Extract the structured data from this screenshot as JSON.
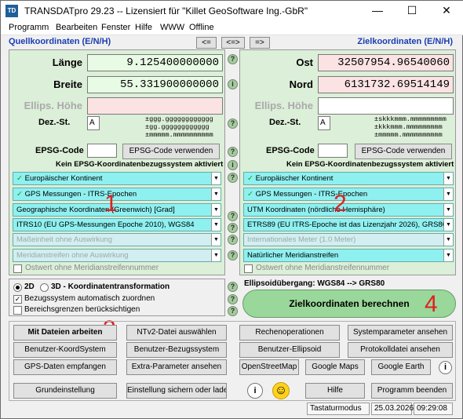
{
  "window": {
    "title": "TRANSDATpro 29.23 -- Lizensiert für \"Killet GeoSoftware Ing.-GbR\"",
    "icon": "TD",
    "controls": [
      "—",
      "☐",
      "✕"
    ]
  },
  "menu": [
    "Programm",
    "Bearbeiten",
    "Fenster",
    "Hilfe",
    "WWW",
    "Offline"
  ],
  "source": {
    "header": "Quellkoordinaten (E/N/H)",
    "label1": "Länge",
    "value1": "9.125400000000",
    "label2": "Breite",
    "value2": "55.331900000000",
    "label3": "Ellips. Höhe",
    "value3": "",
    "dez_label": "Dez.-St.",
    "dez_value": "A",
    "fmt": "±ggg.gggggggggggg\n±gg.gggggggggggg\n±mmmmm.mmmmmmmmmm",
    "epsg_label": "EPSG-Code",
    "epsg_value": "",
    "epsg_button": "EPSG-Code verwenden",
    "epsg_status": "Kein EPSG-Koordinatenbezugssystem aktiviert",
    "dropdowns": [
      "Europäischer Kontinent",
      "GPS Messungen - ITRS-Epochen",
      "Geographische Koordinaten (Greenwich) [Grad]",
      "ITRS10 (EU GPS-Messungen Epoche 2010), WGS84",
      "Maßeinheit ohne Auswirkung",
      "Meridianstreifen ohne Auswirkung"
    ],
    "ostwert": "Ostwert ohne Meridianstreifennummer"
  },
  "target": {
    "header": "Zielkoordinaten (E/N/H)",
    "label1": "Ost",
    "value1": "32507954.96540060",
    "label2": "Nord",
    "value2": "6131732.69514149",
    "label3": "Ellips. Höhe",
    "value3": "",
    "dez_label": "Dez.-St.",
    "dez_value": "A",
    "fmt": "±skkkmmm.mmmmmmmmm\n±kkkmmm.mmmmmmmmm\n±mmmmm.mmmmmmmmmm",
    "epsg_label": "EPSG-Code",
    "epsg_value": "",
    "epsg_button": "EPSG-Code verwenden",
    "epsg_status": "Kein EPSG-Koordinatenbezugssystem aktiviert",
    "dropdowns": [
      "Europäischer Kontinent",
      "GPS Messungen - ITRS-Epochen",
      "UTM Koordinaten (nördliche Hemisphäre)",
      "ETRS89 (EU ITRS-Epoche ist das Lizenzjahr 2026), GRS80",
      "Internationales Meter (1.0 Meter)",
      "Natürlicher Meridianstreifen"
    ],
    "ostwert": "Ostwert ohne Meridianstreifennummer"
  },
  "swap": {
    "left": "<=",
    "both": "<=>",
    "right": "=>"
  },
  "options": {
    "radio2d": "2D",
    "radio3d": "3D - Koordinatentransformation",
    "auto": "Bezugssystem automatisch zuordnen",
    "bereich": "Bereichsgrenzen berücksichtigen"
  },
  "ellipsoid": "Ellipsoidübergang: WGS84 --> GRS80",
  "calc_button": "Zielkoordinaten berechnen",
  "markers": [
    "1",
    "2",
    "3",
    "4"
  ],
  "buttons_row1": [
    "Mit Dateien arbeiten",
    "NTv2-Datei auswählen",
    "Rechenoperationen",
    "Systemparameter ansehen"
  ],
  "buttons_row2": [
    "Benutzer-KoordSystem",
    "Benutzer-Bezugssystem",
    "Benutzer-Ellipsoid",
    "Protokolldatei ansehen"
  ],
  "buttons_row3": [
    "GPS-Daten empfangen",
    "Extra-Parameter ansehen",
    "OpenStreetMap",
    "Google Maps",
    "Google Earth"
  ],
  "buttons_row4": [
    "Grundeinstellung",
    "Einstellung sichern oder laden",
    "Hilfe",
    "Programm beenden"
  ],
  "status": {
    "mode": "Tastaturmodus",
    "date": "25.03.2026",
    "time": "09:29:08"
  },
  "glyphs": {
    "help": "?",
    "info": "i",
    "check": "✓",
    "dd": "▼",
    "smiley": "☺"
  },
  "colors": {
    "header_blue": "#1a3db0",
    "accent_red": "#e02020",
    "dropdown_cyan": "#8ff0f0"
  }
}
